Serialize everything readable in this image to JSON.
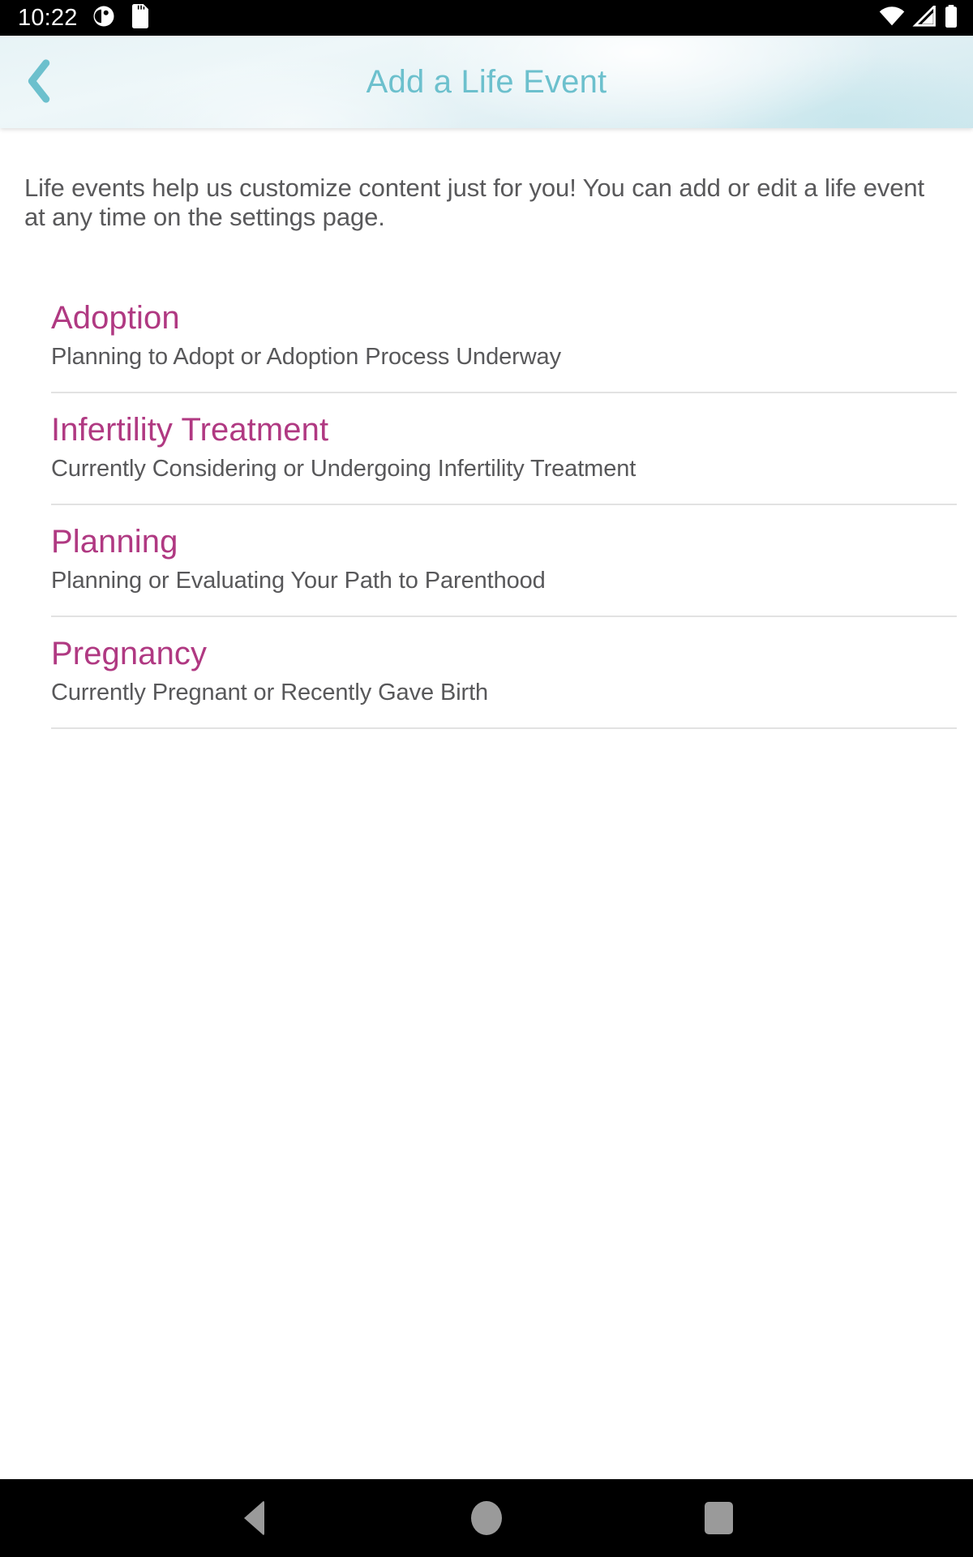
{
  "status_bar": {
    "time": "10:22",
    "left_icons": [
      "notification-circle-icon",
      "sd-card-icon"
    ],
    "right_icons": [
      "wifi-icon",
      "cellular-signal-icon",
      "battery-icon"
    ]
  },
  "header": {
    "title": "Add a Life Event",
    "back_label": "Back",
    "title_color": "#6cc0cd",
    "background_color": "#e3f1f5"
  },
  "content": {
    "intro": "Life events help us customize content just for you! You can add or edit a life event at any time on the settings page.",
    "accent_color": "#b03982",
    "body_color": "#58585a",
    "divider_color": "#e2e2e2",
    "life_events": [
      {
        "title": "Adoption",
        "subtitle": "Planning to Adopt or Adoption Process Underway"
      },
      {
        "title": "Infertility Treatment",
        "subtitle": "Currently Considering or Undergoing Infertility Treatment"
      },
      {
        "title": "Planning",
        "subtitle": "Planning or Evaluating Your Path to Parenthood"
      },
      {
        "title": "Pregnancy",
        "subtitle": "Currently Pregnant or Recently Gave Birth"
      }
    ]
  },
  "nav_bar": {
    "back_label": "Back",
    "home_label": "Home",
    "recents_label": "Recent apps",
    "icon_color": "#9a9a9a"
  }
}
